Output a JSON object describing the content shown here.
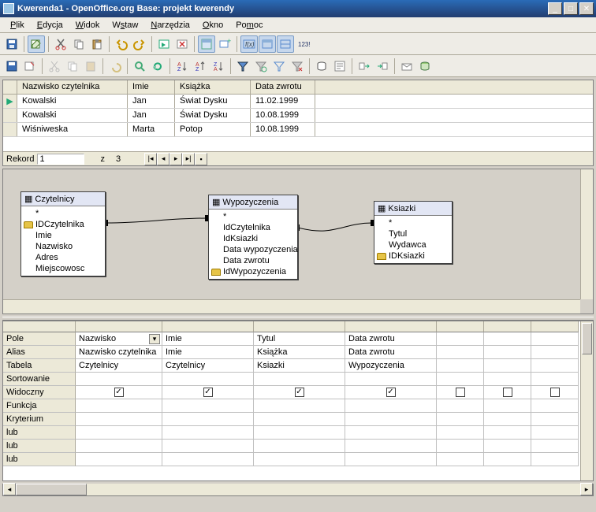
{
  "title": "Kwerenda1 - OpenOffice.org Base: projekt kwerendy",
  "menu": [
    "Plik",
    "Edycja",
    "Widok",
    "Wstaw",
    "Narzędzia",
    "Okno",
    "Pomoc"
  ],
  "results": {
    "headers": [
      "Nazwisko czytelnika",
      "Imie",
      "Książka",
      "Data zwrotu"
    ],
    "rows": [
      [
        "Kowalski",
        "Jan",
        "Świat Dysku",
        "11.02.1999"
      ],
      [
        "Kowalski",
        "Jan",
        "Świat Dysku",
        "10.08.1999"
      ],
      [
        "Wiśniweska",
        "Marta",
        "Potop",
        "10.08.1999"
      ]
    ]
  },
  "recnav": {
    "label": "Rekord",
    "current": "1",
    "z": "z",
    "total": "3"
  },
  "tables": {
    "czytelnicy": {
      "title": "Czytelnicy",
      "fields": [
        "*",
        "IDCzytelnika",
        "Imie",
        "Nazwisko",
        "Adres",
        "Miejscowosc"
      ],
      "keys": [
        1
      ]
    },
    "wypozyczenia": {
      "title": "Wypozyczenia",
      "fields": [
        "*",
        "IdCzytelnika",
        "IdKsiazki",
        "Data wypozyczenia",
        "Data zwrotu",
        "IdWypozyczenia"
      ],
      "keys": [
        5
      ]
    },
    "ksiazki": {
      "title": "Ksiazki",
      "fields": [
        "*",
        "Tytul",
        "Wydawca",
        "IDKsiazki"
      ],
      "keys": [
        3
      ]
    }
  },
  "design": {
    "rows": [
      "Pole",
      "Alias",
      "Tabela",
      "Sortowanie",
      "Widoczny",
      "Funkcja",
      "Kryterium",
      "lub",
      "lub",
      "lub"
    ],
    "cols": [
      {
        "pole": "Nazwisko",
        "alias": "Nazwisko czytelnika",
        "tabela": "Czytelnicy",
        "widoczny": true
      },
      {
        "pole": "Imie",
        "alias": "Imie",
        "tabela": "Czytelnicy",
        "widoczny": true
      },
      {
        "pole": "Tytul",
        "alias": "Książka",
        "tabela": "Ksiazki",
        "widoczny": true
      },
      {
        "pole": "Data zwrotu",
        "alias": "Data zwrotu",
        "tabela": "Wypozyczenia",
        "widoczny": true
      },
      {
        "pole": "",
        "alias": "",
        "tabela": "",
        "widoczny": false
      },
      {
        "pole": "",
        "alias": "",
        "tabela": "",
        "widoczny": false
      },
      {
        "pole": "",
        "alias": "",
        "tabela": "",
        "widoczny": false
      }
    ]
  }
}
